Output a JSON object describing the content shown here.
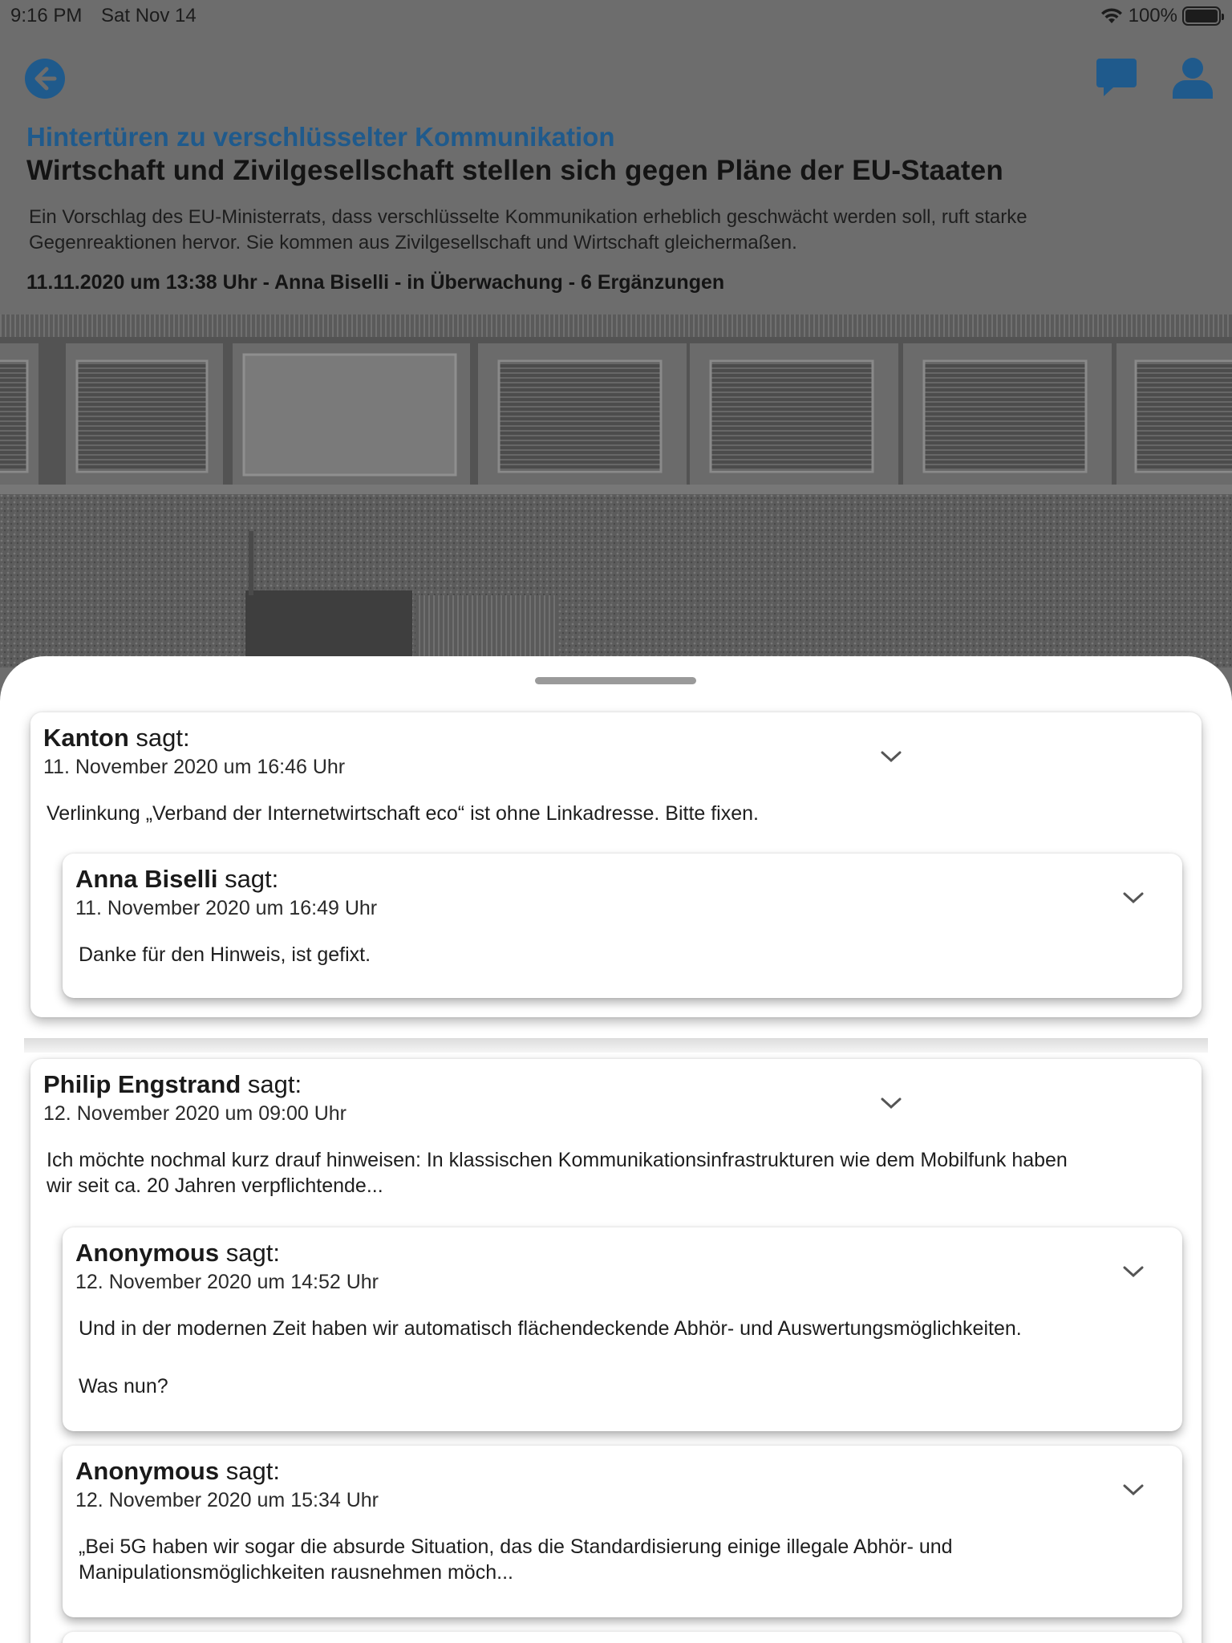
{
  "status_bar": {
    "time": "9:16 PM",
    "date": "Sat Nov 14",
    "battery": "100%"
  },
  "nav": {
    "back_icon": "arrow-left-circle-icon",
    "comments_icon": "speech-bubble-icon",
    "profile_icon": "person-icon"
  },
  "article": {
    "overline": "Hintertüren zu verschlüsselter Kommunikation",
    "headline": "Wirtschaft und Zivilgesellschaft stellen sich gegen Pläne der EU-Staaten",
    "teaser_line1": "Ein Vorschlag des EU-Ministerrats, dass verschlüsselte Kommunikation erheblich geschwächt werden soll, ruft starke",
    "teaser_line2": "Gegenreaktionen hervor. Sie kommen aus Zivilgesellschaft und Wirtschaft gleichermaßen.",
    "meta": "11.11.2020 um 13:38 Uhr - Anna Biselli - in Überwachung - 6 Ergänzungen"
  },
  "comments": [
    {
      "author": "Kanton",
      "says": "sagt:",
      "date": "11. November 2020 um 16:46 Uhr",
      "body": "Verlinkung „Verband der Internetwirtschaft eco“ ist ohne Linkadresse. Bitte fixen.",
      "replies": [
        {
          "author": "Anna Biselli",
          "says": "sagt:",
          "date": "11. November 2020 um 16:49 Uhr",
          "body": "Danke für den Hinweis, ist gefixt."
        }
      ]
    },
    {
      "author": "Philip Engstrand",
      "says": "sagt:",
      "date": "12. November 2020 um 09:00 Uhr",
      "body_line1": "Ich möchte nochmal kurz drauf hinweisen: In klassischen Kommunikationsinfrastrukturen wie dem Mobilfunk haben",
      "body_line2": "wir seit ca. 20 Jahren verpflichtende...",
      "replies": [
        {
          "author": "Anonymous",
          "says": "sagt:",
          "date": "12. November 2020 um 14:52 Uhr",
          "body_line1": "Und in der modernen Zeit haben wir automatisch flächendeckende Abhör- und Auswertungsmöglichkeiten.",
          "body_line2": "Was nun?"
        },
        {
          "author": "Anonymous",
          "says": "sagt:",
          "date": "12. November 2020 um 15:34 Uhr",
          "body_line1": "„Bei 5G haben wir sogar die absurde Situation, das die Standardisierung einige illegale Abhör- und",
          "body_line2": "Manipulationsmöglichkeiten rausnehmen möch..."
        }
      ]
    }
  ],
  "colors": {
    "accent": "#1f5a8c",
    "dim_background": "#6d6d6d",
    "sheet": "#ffffff"
  }
}
